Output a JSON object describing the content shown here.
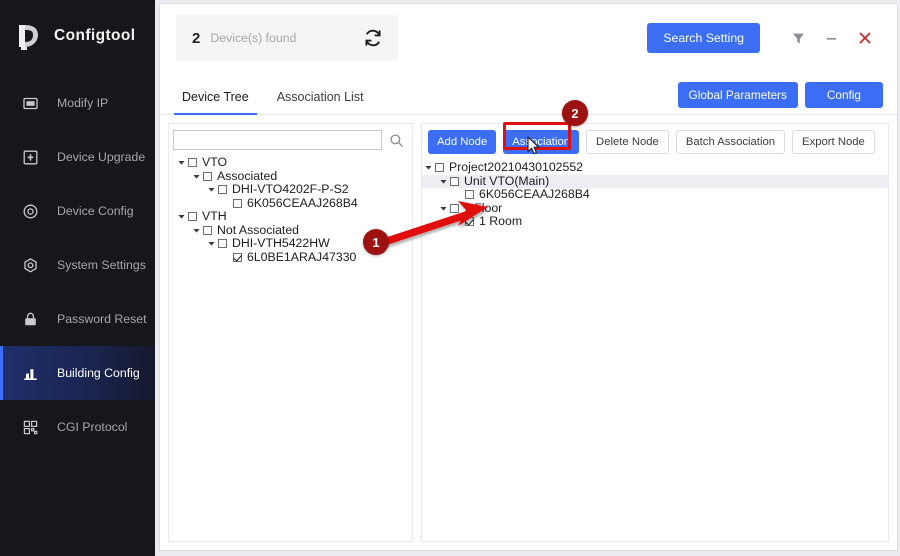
{
  "app": {
    "brand": "Configtool",
    "logo_icon": "dahua-logo-icon"
  },
  "sidebar": {
    "items": [
      {
        "label": "Modify IP",
        "icon": "ip-card-icon",
        "active": false
      },
      {
        "label": "Device Upgrade",
        "icon": "upgrade-box-icon",
        "active": false
      },
      {
        "label": "Device Config",
        "icon": "target-circle-icon",
        "active": false
      },
      {
        "label": "System Settings",
        "icon": "hex-gear-icon",
        "active": false
      },
      {
        "label": "Password Reset",
        "icon": "lock-icon",
        "active": false
      },
      {
        "label": "Building Config",
        "icon": "bar-chart-icon",
        "active": true
      },
      {
        "label": "CGI Protocol",
        "icon": "qr-blocks-icon",
        "active": false
      }
    ]
  },
  "header": {
    "device_count": "2",
    "device_found_label": "Device(s) found",
    "refresh_icon": "refresh-icon",
    "search_setting_label": "Search Setting",
    "filter_icon": "filter-funnel-icon",
    "minimize_icon": "minimize-icon",
    "close_icon": "close-icon"
  },
  "tabs": [
    {
      "label": "Device Tree",
      "active": true
    },
    {
      "label": "Association List",
      "active": false
    }
  ],
  "tab_actions": {
    "global_parameters_label": "Global Parameters",
    "config_label": "Config"
  },
  "left_pane": {
    "search_value": "",
    "search_placeholder": "",
    "search_icon": "search-icon",
    "tree": [
      {
        "label": "VTO",
        "indent": 1,
        "caret": "down",
        "checked": false,
        "selected": false
      },
      {
        "label": "Associated",
        "indent": 2,
        "caret": "down",
        "checked": false,
        "selected": false
      },
      {
        "label": "DHI-VTO4202F-P-S2",
        "indent": 3,
        "caret": "down",
        "checked": false,
        "selected": false
      },
      {
        "label": "6K056CEAAJ268B4",
        "indent": 4,
        "caret": "none",
        "checked": false,
        "selected": false
      },
      {
        "label": "VTH",
        "indent": 1,
        "caret": "down",
        "checked": false,
        "selected": false
      },
      {
        "label": "Not Associated",
        "indent": 2,
        "caret": "down",
        "checked": false,
        "selected": false
      },
      {
        "label": "DHI-VTH5422HW",
        "indent": 3,
        "caret": "down",
        "checked": false,
        "selected": false
      },
      {
        "label": "6L0BE1ARAJ47330",
        "indent": 4,
        "caret": "none",
        "checked": true,
        "selected": false
      }
    ]
  },
  "right_pane": {
    "buttons": [
      {
        "label": "Add Node",
        "style": "primary",
        "highlighted": false
      },
      {
        "label": "Association",
        "style": "primary",
        "highlighted": true
      },
      {
        "label": "Delete Node",
        "style": "ghost",
        "highlighted": false
      },
      {
        "label": "Batch Association",
        "style": "ghost",
        "highlighted": false
      },
      {
        "label": "Export Node",
        "style": "ghost",
        "highlighted": false
      }
    ],
    "tree": [
      {
        "label": "Project20210430102552",
        "indent": 1,
        "caret": "down",
        "checked": false,
        "selected": false
      },
      {
        "label": "Unit VTO(Main)",
        "indent": 2,
        "caret": "down",
        "checked": false,
        "selected": true
      },
      {
        "label": "6K056CEAAJ268B4",
        "indent": 3,
        "caret": "none",
        "checked": false,
        "selected": false
      },
      {
        "label": "1 Floor",
        "indent": 2,
        "caret": "down",
        "checked": false,
        "selected": false
      },
      {
        "label": "1 Room",
        "indent": 3,
        "caret": "none",
        "checked": true,
        "selected": false
      }
    ]
  },
  "annotations": {
    "badge_1": "1",
    "badge_2": "2",
    "arrow_color": "#e01010",
    "badge_color": "#9e1111"
  },
  "colors": {
    "accent_blue": "#3b6ef5",
    "sidebar_bg": "#17171b",
    "sidebar_active": "#1e2f6b",
    "close_red": "#c9302c",
    "annotation_red": "#e01010"
  }
}
